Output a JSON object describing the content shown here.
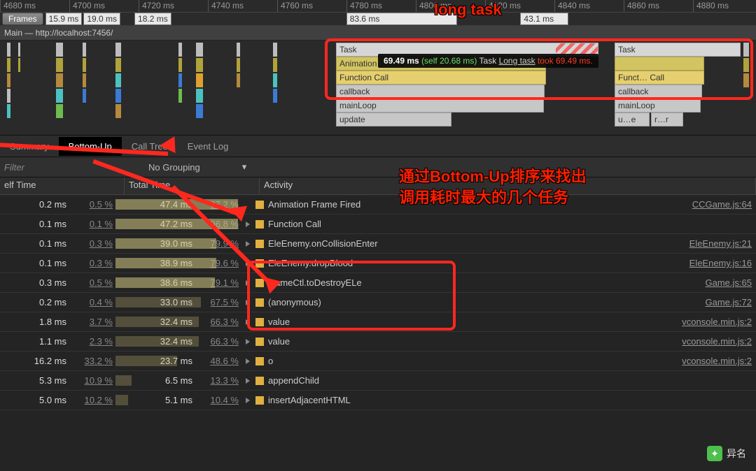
{
  "ruler": [
    "4680 ms",
    "4700 ms",
    "4720 ms",
    "4740 ms",
    "4760 ms",
    "4780 ms",
    "4800 ms",
    "4820 ms",
    "4840 ms",
    "4860 ms",
    "4880 ms"
  ],
  "ruler_highlight": "long  task",
  "frames": {
    "label": "Frames",
    "items": [
      "15.9 ms",
      "19.0 ms",
      "18.2 ms",
      "83.6 ms",
      "43.1 ms"
    ]
  },
  "main_header": " Main — http://localhost:7456/",
  "stack_left": {
    "task": "Task",
    "anim": "Animation",
    "func": "Function Call",
    "cb": "callback",
    "loop": "mainLoop",
    "upd": "update"
  },
  "stack_right": {
    "task": "Task",
    "anim": "",
    "func": "Funct… Call",
    "cb": "callback",
    "loop": "mainLoop",
    "u": "u…e",
    "r": "r…r"
  },
  "tooltip": {
    "ms": "69.49 ms",
    "self": "(self 20.68 ms)",
    "task": "Task",
    "long": "Long task",
    "took": "took 69.49 ms."
  },
  "big_annotation": "通过Bottom-Up排序来找出\n调用耗时最大的几个任务",
  "tabs": [
    "Summary",
    "Bottom-Up",
    "Call Tree",
    "Event Log"
  ],
  "filter_placeholder": "Filter",
  "grouping": "No Grouping",
  "thead": {
    "self": "elf Time",
    "total": "Total Time",
    "act": "Activity"
  },
  "rows": [
    {
      "s": "0.2 ms",
      "sp": "0.5 %",
      "t": "47.4 ms",
      "tp": "97.2 %",
      "bar": 97,
      "act": "Animation Frame Fired",
      "tri": false,
      "src": "CCGame.js:64"
    },
    {
      "s": "0.1 ms",
      "sp": "0.1 %",
      "t": "47.2 ms",
      "tp": "96.8 %",
      "bar": 97,
      "act": "Function Call",
      "tri": true,
      "src": ""
    },
    {
      "s": "0.1 ms",
      "sp": "0.3 %",
      "t": "39.0 ms",
      "tp": "79.9 %",
      "bar": 80,
      "act": "EleEnemy.onCollisionEnter",
      "tri": true,
      "src": "EleEnemy.js:21"
    },
    {
      "s": "0.1 ms",
      "sp": "0.3 %",
      "t": "38.9 ms",
      "tp": "79.6 %",
      "bar": 80,
      "act": "EleEnemy.dropBlood",
      "tri": true,
      "src": "EleEnemy.js:16"
    },
    {
      "s": "0.3 ms",
      "sp": "0.5 %",
      "t": "38.6 ms",
      "tp": "79.1 %",
      "bar": 79,
      "act": "GameCtl.toDestroyELe",
      "tri": true,
      "src": "Game.js:65"
    },
    {
      "s": "0.2 ms",
      "sp": "0.4 %",
      "t": "33.0 ms",
      "tp": "67.5 %",
      "bar": 68,
      "act": "(anonymous)",
      "tri": true,
      "src": "Game.js:72"
    },
    {
      "s": "1.8 ms",
      "sp": "3.7 %",
      "t": "32.4 ms",
      "tp": "66.3 %",
      "bar": 66,
      "act": "value",
      "tri": true,
      "src": "vconsole.min.js:2"
    },
    {
      "s": "1.1 ms",
      "sp": "2.3 %",
      "t": "32.4 ms",
      "tp": "66.3 %",
      "bar": 66,
      "act": "value",
      "tri": true,
      "src": "vconsole.min.js:2"
    },
    {
      "s": "16.2 ms",
      "sp": "33.2 %",
      "t": "23.7 ms",
      "tp": "48.6 %",
      "bar": 49,
      "act": "o",
      "tri": true,
      "src": "vconsole.min.js:2"
    },
    {
      "s": "5.3 ms",
      "sp": "10.9 %",
      "t": "6.5 ms",
      "tp": "13.3 %",
      "bar": 13,
      "act": "appendChild",
      "tri": true,
      "src": ""
    },
    {
      "s": "5.0 ms",
      "sp": "10.2 %",
      "t": "5.1 ms",
      "tp": "10.4 %",
      "bar": 10,
      "act": "insertAdjacentHTML",
      "tri": true,
      "src": ""
    }
  ],
  "watermark": "异名"
}
